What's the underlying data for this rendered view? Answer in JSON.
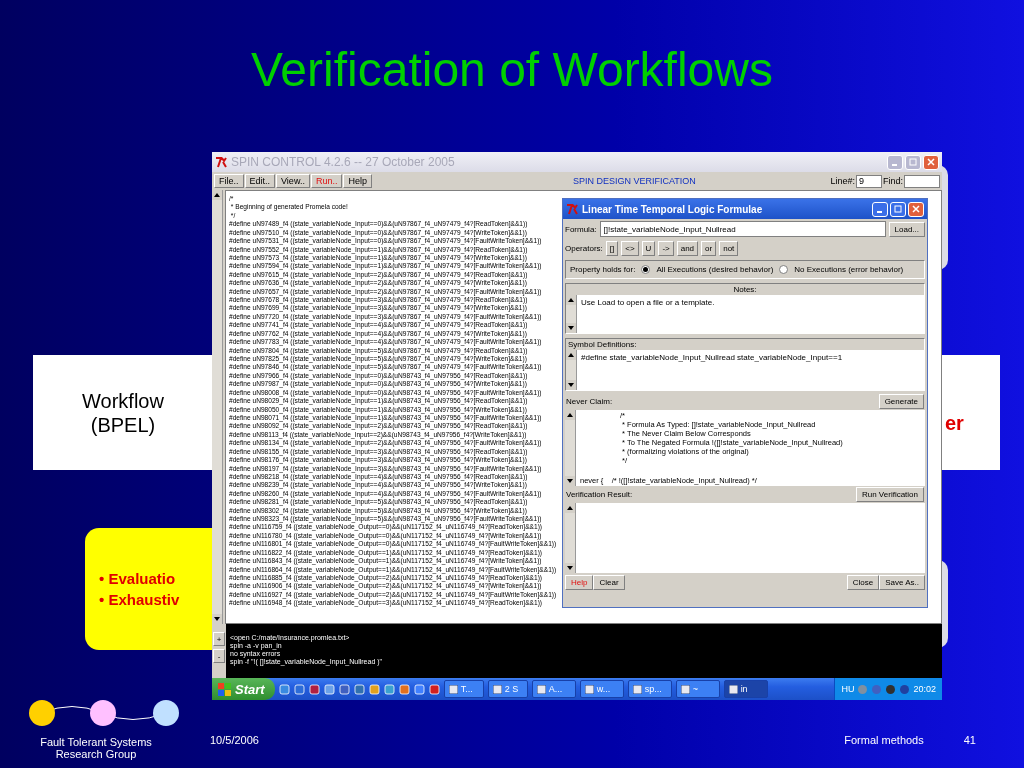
{
  "slide": {
    "title": "Verification of Workflows"
  },
  "backdrop": {
    "workflow_label": [
      "Workflow",
      "(BPEL)"
    ],
    "right_fragment": "er",
    "bullet_char": "•",
    "bullets": [
      "Evaluatio",
      "Exhaustiv"
    ]
  },
  "spin_window": {
    "title": "SPIN CONTROL 4.2.6 -- 27 October 2005",
    "menu": [
      {
        "label": "File..",
        "highlighted": false
      },
      {
        "label": "Edit..",
        "highlighted": false
      },
      {
        "label": "View..",
        "highlighted": false
      },
      {
        "label": "Run..",
        "highlighted": true
      },
      {
        "label": "Help",
        "highlighted": false
      }
    ],
    "center_label": "SPIN DESIGN VERIFICATION",
    "line_label": "Line#:",
    "line_value": "9",
    "find_label": "Find:",
    "source_lines": [
      "/*",
      " * Beginning of generated Promela code!",
      " */",
      "#define uN97489_f4 ((state_variableNode_Input==0)&&(uN97867_f4_uN97479_f4?[ReadToken]&&1))",
      "#define uN97510_f4 ((state_variableNode_Input==0)&&(uN97867_f4_uN97479_f4?[WriteToken]&&1))",
      "#define uN97531_f4 ((state_variableNode_Input==0)&&(uN97867_f4_uN97479_f4?[FaultWriteToken]&&1))",
      "#define uN97552_f4 ((state_variableNode_Input==1)&&(uN97867_f4_uN97479_f4?[ReadToken]&&1))",
      "#define uN97573_f4 ((state_variableNode_Input==1)&&(uN97867_f4_uN97479_f4?[WriteToken]&&1))",
      "#define uN97594_f4 ((state_variableNode_Input==1)&&(uN97867_f4_uN97479_f4?[FaultWriteToken]&&1))",
      "#define uN97615_f4 ((state_variableNode_Input==2)&&(uN97867_f4_uN97479_f4?[ReadToken]&&1))",
      "#define uN97636_f4 ((state_variableNode_Input==2)&&(uN97867_f4_uN97479_f4?[WriteToken]&&1))",
      "#define uN97657_f4 ((state_variableNode_Input==2)&&(uN97867_f4_uN97479_f4?[FaultWriteToken]&&1))",
      "#define uN97678_f4 ((state_variableNode_Input==3)&&(uN97867_f4_uN97479_f4?[ReadToken]&&1))",
      "#define uN97699_f4 ((state_variableNode_Input==3)&&(uN97867_f4_uN97479_f4?[WriteToken]&&1))",
      "#define uN97720_f4 ((state_variableNode_Input==3)&&(uN97867_f4_uN97479_f4?[FaultWriteToken]&&1))",
      "#define uN97741_f4 ((state_variableNode_Input==4)&&(uN97867_f4_uN97479_f4?[ReadToken]&&1))",
      "#define uN97762_f4 ((state_variableNode_Input==4)&&(uN97867_f4_uN97479_f4?[WriteToken]&&1))",
      "#define uN97783_f4 ((state_variableNode_Input==4)&&(uN97867_f4_uN97479_f4?[FaultWriteToken]&&1))",
      "#define uN97804_f4 ((state_variableNode_Input==5)&&(uN97867_f4_uN97479_f4?[ReadToken]&&1))",
      "#define uN97825_f4 ((state_variableNode_Input==5)&&(uN97867_f4_uN97479_f4?[WriteToken]&&1))",
      "#define uN97846_f4 ((state_variableNode_Input==5)&&(uN97867_f4_uN97479_f4?[FaultWriteToken]&&1))",
      "#define uN97966_f4 ((state_variableNode_Input==0)&&(uN98743_f4_uN97956_f4?[ReadToken]&&1))",
      "#define uN97987_f4 ((state_variableNode_Input==0)&&(uN98743_f4_uN97956_f4?[WriteToken]&&1))",
      "#define uN98008_f4 ((state_variableNode_Input==0)&&(uN98743_f4_uN97956_f4?[FaultWriteToken]&&1))",
      "#define uN98029_f4 ((state_variableNode_Input==1)&&(uN98743_f4_uN97956_f4?[ReadToken]&&1))",
      "#define uN98050_f4 ((state_variableNode_Input==1)&&(uN98743_f4_uN97956_f4?[WriteToken]&&1))",
      "#define uN98071_f4 ((state_variableNode_Input==1)&&(uN98743_f4_uN97956_f4?[FaultWriteToken]&&1))",
      "#define uN98092_f4 ((state_variableNode_Input==2)&&(uN98743_f4_uN97956_f4?[ReadToken]&&1))",
      "#define uN98113_f4 ((state_variableNode_Input==2)&&(uN98743_f4_uN97956_f4?[WriteToken]&&1))",
      "#define uN98134_f4 ((state_variableNode_Input==2)&&(uN98743_f4_uN97956_f4?[FaultWriteToken]&&1))",
      "#define uN98155_f4 ((state_variableNode_Input==3)&&(uN98743_f4_uN97956_f4?[ReadToken]&&1))",
      "#define uN98176_f4 ((state_variableNode_Input==3)&&(uN98743_f4_uN97956_f4?[WriteToken]&&1))",
      "#define uN98197_f4 ((state_variableNode_Input==3)&&(uN98743_f4_uN97956_f4?[FaultWriteToken]&&1))",
      "#define uN98218_f4 ((state_variableNode_Input==4)&&(uN98743_f4_uN97956_f4?[ReadToken]&&1))",
      "#define uN98239_f4 ((state_variableNode_Input==4)&&(uN98743_f4_uN97956_f4?[WriteToken]&&1))",
      "#define uN98260_f4 ((state_variableNode_Input==4)&&(uN98743_f4_uN97956_f4?[FaultWriteToken]&&1))",
      "#define uN98281_f4 ((state_variableNode_Input==5)&&(uN98743_f4_uN97956_f4?[ReadToken]&&1))",
      "#define uN98302_f4 ((state_variableNode_Input==5)&&(uN98743_f4_uN97956_f4?[WriteToken]&&1))",
      "#define uN98323_f4 ((state_variableNode_Input==5)&&(uN98743_f4_uN97956_f4?[FaultWriteToken]&&1))",
      "#define uN116759_f4 ((state_variableNode_Output==0)&&(uN117152_f4_uN116749_f4?[ReadToken]&&1))",
      "#define uN116780_f4 ((state_variableNode_Output==0)&&(uN117152_f4_uN116749_f4?[WriteToken]&&1))",
      "#define uN116801_f4 ((state_variableNode_Output==0)&&(uN117152_f4_uN116749_f4?[FaultWriteToken]&&1))",
      "#define uN116822_f4 ((state_variableNode_Output==1)&&(uN117152_f4_uN116749_f4?[ReadToken]&&1))",
      "#define uN116843_f4 ((state_variableNode_Output==1)&&(uN117152_f4_uN116749_f4?[WriteToken]&&1))",
      "#define uN116864_f4 ((state_variableNode_Output==1)&&(uN117152_f4_uN116749_f4?[FaultWriteToken]&&1))",
      "#define uN116885_f4 ((state_variableNode_Output==2)&&(uN117152_f4_uN116749_f4?[ReadToken]&&1))",
      "#define uN116906_f4 ((state_variableNode_Output==2)&&(uN117152_f4_uN116749_f4?[WriteToken]&&1))",
      "#define uN116927_f4 ((state_variableNode_Output==2)&&(uN117152_f4_uN116749_f4?[FaultWriteToken]&&1))",
      "#define uN116948_f4 ((state_variableNode_Output==3)&&(uN117152_f4_uN116749_f4?[ReadToken]&&1))"
    ],
    "console_buttons": [
      "+",
      "-"
    ],
    "console_lines": [
      "<open C:/mate/Insurance.promlea.txt>",
      "spin -a -v pan_in",
      "no syntax errors",
      "spin -f \"!( []!state_variableNode_Input_Nullread )\""
    ]
  },
  "ltl_dialog": {
    "title": "Linear Time Temporal Logic Formulae",
    "formula_label": "Formula:",
    "formula_value": "[]!state_variableNode_Input_Nullread",
    "load_button": "Load...",
    "operators_label": "Operators:",
    "operators": [
      "[]",
      "<>",
      "U",
      "->",
      "and",
      "or",
      "not"
    ],
    "property_label": "Property holds for:",
    "property_options": [
      {
        "label": "All Executions (desired behavior)",
        "selected": true
      },
      {
        "label": "No Executions (error behavior)",
        "selected": false
      }
    ],
    "notes_label": "Notes:",
    "notes_text": "Use Load to open a file or a template.",
    "symbols_label": "Symbol Definitions:",
    "symbols_text": "#define state_variableNode_Input_Nullread state_variableNode_Input==1",
    "never_label": "Never Claim:",
    "generate_button": "Generate",
    "never_lines": [
      "/*",
      " * Formula As Typed: []!state_variableNode_Input_Nullread",
      " * The Never Claim Below Corresponds",
      " * To The Negated Formula !([]!state_variableNode_Input_Nullread)",
      " * (formalizing violations of the original)",
      " */"
    ],
    "never_last": "never {    /* !([]!state_variableNode_Input_Nullread) */",
    "result_label": "Verification Result:",
    "run_button": "Run Verification",
    "bottom_buttons": [
      {
        "label": "Help",
        "highlighted": true
      },
      {
        "label": "Clear",
        "highlighted": false
      },
      {
        "label": "Close",
        "highlighted": false
      },
      {
        "label": "Save As..",
        "highlighted": false
      }
    ]
  },
  "taskbar": {
    "start": "Start",
    "tasks": [
      {
        "label": "T...",
        "selected": false
      },
      {
        "label": "2 S",
        "selected": false
      },
      {
        "label": "A...",
        "selected": false
      },
      {
        "label": "w...",
        "selected": false
      },
      {
        "label": "sp...",
        "selected": false
      },
      {
        "label": "~",
        "selected": false
      },
      {
        "label": "in",
        "selected": true
      }
    ],
    "language": "HU",
    "clock": "20:02"
  },
  "footer": {
    "group": [
      "Fault Tolerant Systems",
      "Research Group"
    ],
    "date": "10/5/2006",
    "topic": "Formal methods",
    "page": "41"
  }
}
